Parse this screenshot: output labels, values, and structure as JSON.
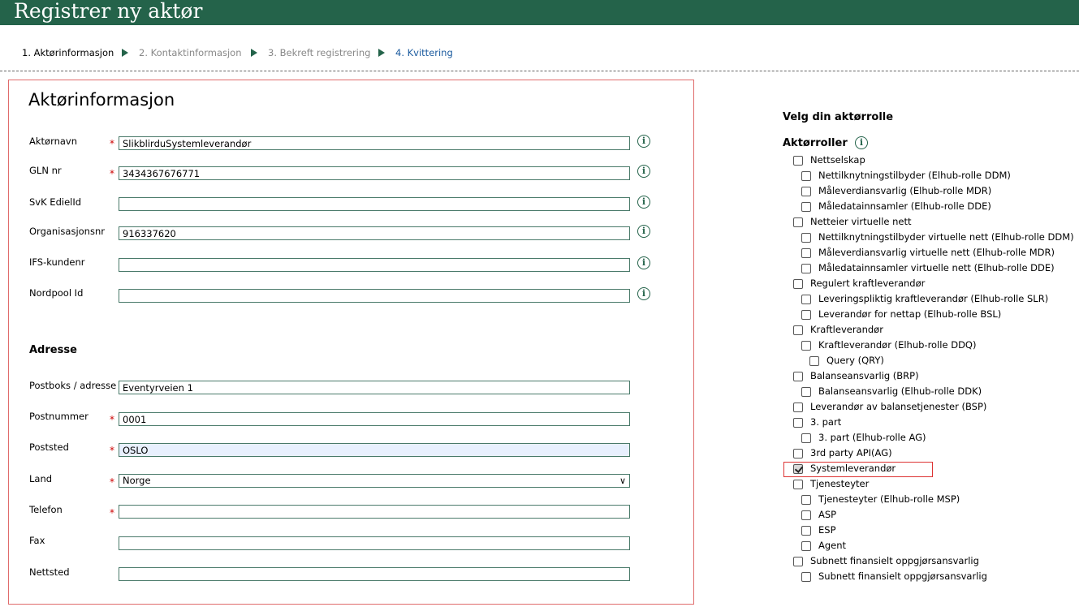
{
  "header": {
    "title": "Registrer ny aktør"
  },
  "steps": [
    {
      "label": "1. Aktørinformasjon",
      "state": "active"
    },
    {
      "label": "2. Kontaktinformasjon",
      "state": "disabled"
    },
    {
      "label": "3. Bekreft registrering",
      "state": "disabled"
    },
    {
      "label": "4. Kvittering",
      "state": "link"
    }
  ],
  "form": {
    "title": "Aktørinformasjon",
    "address_title": "Adresse",
    "fields": {
      "aktornavn": {
        "label": "Aktørnavn",
        "value": "SlikblirduSystemleverandør",
        "required": true
      },
      "gln": {
        "label": "GLN nr",
        "value": "3434367676771",
        "required": true
      },
      "svk": {
        "label": "SvK EdielId",
        "value": "",
        "required": false
      },
      "orgnr": {
        "label": "Organisasjonsnr",
        "value": "916337620",
        "required": false
      },
      "ifs": {
        "label": "IFS-kundenr",
        "value": "",
        "required": false
      },
      "nordpool": {
        "label": "Nordpool Id",
        "value": "",
        "required": false
      },
      "postboks": {
        "label": "Postboks / adresse",
        "value": "Eventyrveien 1",
        "required": false
      },
      "postnummer": {
        "label": "Postnummer",
        "value": "0001",
        "required": true
      },
      "poststed": {
        "label": "Poststed",
        "value": "OSLO",
        "required": true
      },
      "land": {
        "label": "Land",
        "value": "Norge",
        "required": true
      },
      "telefon": {
        "label": "Telefon",
        "value": "",
        "required": true
      },
      "fax": {
        "label": "Fax",
        "value": "",
        "required": false
      },
      "nettsted": {
        "label": "Nettsted",
        "value": "",
        "required": false
      }
    },
    "required_marker": "*"
  },
  "sidebar": {
    "title": "Velg din aktørrolle",
    "roles_title": "Aktørroller",
    "roles": [
      {
        "label": "Nettselskap",
        "level": 0,
        "checked": false
      },
      {
        "label": "Nettilknytningstilbyder (Elhub-rolle DDM)",
        "level": 1,
        "checked": false
      },
      {
        "label": "Måleverdiansvarlig (Elhub-rolle MDR)",
        "level": 1,
        "checked": false
      },
      {
        "label": "Måledatainnsamler (Elhub-rolle DDE)",
        "level": 1,
        "checked": false
      },
      {
        "label": "Netteier virtuelle nett",
        "level": 0,
        "checked": false
      },
      {
        "label": "Nettilknytningstilbyder virtuelle nett (Elhub-rolle DDM)",
        "level": 1,
        "checked": false
      },
      {
        "label": "Måleverdiansvarlig virtuelle nett (Elhub-rolle MDR)",
        "level": 1,
        "checked": false
      },
      {
        "label": "Måledatainnsamler virtuelle nett (Elhub-rolle DDE)",
        "level": 1,
        "checked": false
      },
      {
        "label": "Regulert kraftleverandør",
        "level": 0,
        "checked": false
      },
      {
        "label": "Leveringspliktig kraftleverandør (Elhub-rolle SLR)",
        "level": 1,
        "checked": false
      },
      {
        "label": "Leverandør for nettap (Elhub-rolle BSL)",
        "level": 1,
        "checked": false
      },
      {
        "label": "Kraftleverandør",
        "level": 0,
        "checked": false
      },
      {
        "label": "Kraftleverandør (Elhub-rolle DDQ)",
        "level": 1,
        "checked": false
      },
      {
        "label": "Query (QRY)",
        "level": 2,
        "checked": false
      },
      {
        "label": "Balanseansvarlig (BRP)",
        "level": 0,
        "checked": false
      },
      {
        "label": "Balanseansvarlig (Elhub-rolle DDK)",
        "level": 1,
        "checked": false
      },
      {
        "label": "Leverandør av balansetjenester (BSP)",
        "level": 0,
        "checked": false
      },
      {
        "label": "3. part",
        "level": 0,
        "checked": false
      },
      {
        "label": "3. part (Elhub-rolle AG)",
        "level": 1,
        "checked": false
      },
      {
        "label": "3rd party API(AG)",
        "level": 0,
        "checked": false
      },
      {
        "label": "Systemleverandør",
        "level": 0,
        "checked": true
      },
      {
        "label": "Tjenesteyter",
        "level": 0,
        "checked": false
      },
      {
        "label": "Tjenesteyter (Elhub-rolle MSP)",
        "level": 1,
        "checked": false
      },
      {
        "label": "ASP",
        "level": 1,
        "checked": false
      },
      {
        "label": "ESP",
        "level": 1,
        "checked": false
      },
      {
        "label": "Agent",
        "level": 1,
        "checked": false
      },
      {
        "label": "Subnett finansielt oppgjørsansvarlig",
        "level": 0,
        "checked": false
      },
      {
        "label": "Subnett finansielt oppgjørsansvarlig",
        "level": 1,
        "checked": false
      }
    ]
  },
  "colors": {
    "header_bg": "#24634a",
    "highlight_border": "#dd3333",
    "required": "#cc0000"
  },
  "icons": {
    "info": "info-circle-icon",
    "step_arrow": "chevron-right-icon"
  }
}
